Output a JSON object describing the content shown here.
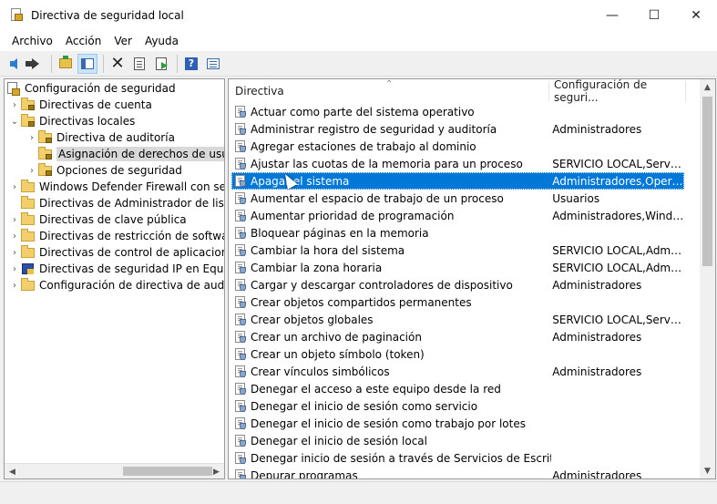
{
  "window": {
    "title": "Directiva de seguridad local",
    "minimize": "—",
    "maximize": "☐",
    "close": "✕"
  },
  "menu": [
    "Archivo",
    "Acción",
    "Ver",
    "Ayuda"
  ],
  "toolbar": {
    "icons": [
      "back-icon",
      "forward-icon",
      "up-folder-icon",
      "show-hide-tree-icon",
      "delete-icon",
      "properties-page-icon",
      "export-list-icon",
      "help-icon",
      "action-pane-icon"
    ]
  },
  "tree": {
    "items": [
      {
        "label": "Configuración de seguridad",
        "twisty": "",
        "icon": "security-settings-icon"
      },
      {
        "label": "Directivas de cuenta",
        "twisty": "›",
        "icon": "folder-lock-icon"
      },
      {
        "label": "Directivas locales",
        "twisty": "⌄",
        "icon": "folder-lock-icon"
      },
      {
        "label": "Directiva de auditoría",
        "twisty": "›",
        "icon": "folder-lock-icon"
      },
      {
        "label": "Asignación de derechos de usuario",
        "twisty": "",
        "icon": "folder-lock-icon"
      },
      {
        "label": "Opciones de seguridad",
        "twisty": "›",
        "icon": "folder-lock-icon"
      },
      {
        "label": "Windows Defender Firewall con seguridad avanzada",
        "twisty": "›",
        "icon": "folder-icon"
      },
      {
        "label": "Directivas de Administrador de listas de redes",
        "twisty": "",
        "icon": "folder-icon"
      },
      {
        "label": "Directivas de clave pública",
        "twisty": "›",
        "icon": "folder-icon"
      },
      {
        "label": "Directivas de restricción de software",
        "twisty": "›",
        "icon": "folder-icon"
      },
      {
        "label": "Directivas de control de aplicaciones",
        "twisty": "›",
        "icon": "folder-icon"
      },
      {
        "label": "Directivas de seguridad IP en Equipo local",
        "twisty": "›",
        "icon": "ipsec-icon"
      },
      {
        "label": "Configuración de directiva de auditoría avanzada",
        "twisty": "›",
        "icon": "folder-icon"
      }
    ]
  },
  "list": {
    "columns": [
      "Directiva",
      "Configuración de seguri..."
    ],
    "sort_indicator": "⌃",
    "rows": [
      {
        "name": "Actuar como parte del sistema operativo",
        "setting": ""
      },
      {
        "name": "Administrar registro de seguridad y auditoría",
        "setting": "Administradores"
      },
      {
        "name": "Agregar estaciones de trabajo al dominio",
        "setting": ""
      },
      {
        "name": "Ajustar las cuotas de la memoria para un proceso",
        "setting": "SERVICIO LOCAL,Servici..."
      },
      {
        "name": "Apagar el sistema",
        "setting": "Administradores,Operad..."
      },
      {
        "name": "Aumentar el espacio de trabajo de un proceso",
        "setting": "Usuarios"
      },
      {
        "name": "Aumentar prioridad de programación",
        "setting": "Administradores,Windo..."
      },
      {
        "name": "Bloquear páginas en la memoria",
        "setting": ""
      },
      {
        "name": "Cambiar la hora del sistema",
        "setting": "SERVICIO LOCAL,Admin..."
      },
      {
        "name": "Cambiar la zona horaria",
        "setting": "SERVICIO LOCAL,Admin..."
      },
      {
        "name": "Cargar y descargar controladores de dispositivo",
        "setting": "Administradores"
      },
      {
        "name": "Crear objetos compartidos permanentes",
        "setting": ""
      },
      {
        "name": "Crear objetos globales",
        "setting": "SERVICIO LOCAL,Servici..."
      },
      {
        "name": "Crear un archivo de paginación",
        "setting": "Administradores"
      },
      {
        "name": "Crear un objeto símbolo (token)",
        "setting": ""
      },
      {
        "name": "Crear vínculos simbólicos",
        "setting": "Administradores"
      },
      {
        "name": "Denegar el acceso a este equipo desde la red",
        "setting": ""
      },
      {
        "name": "Denegar el inicio de sesión como servicio",
        "setting": ""
      },
      {
        "name": "Denegar el inicio de sesión como trabajo por lotes",
        "setting": ""
      },
      {
        "name": "Denegar el inicio de sesión local",
        "setting": ""
      },
      {
        "name": "Denegar inicio de sesión a través de Servicios de Escritorio re...",
        "setting": ""
      },
      {
        "name": "Depurar programas",
        "setting": "Administradores"
      }
    ]
  },
  "colors": {
    "selection": "#0078d7",
    "tree_selection": "#d9d9d9"
  }
}
